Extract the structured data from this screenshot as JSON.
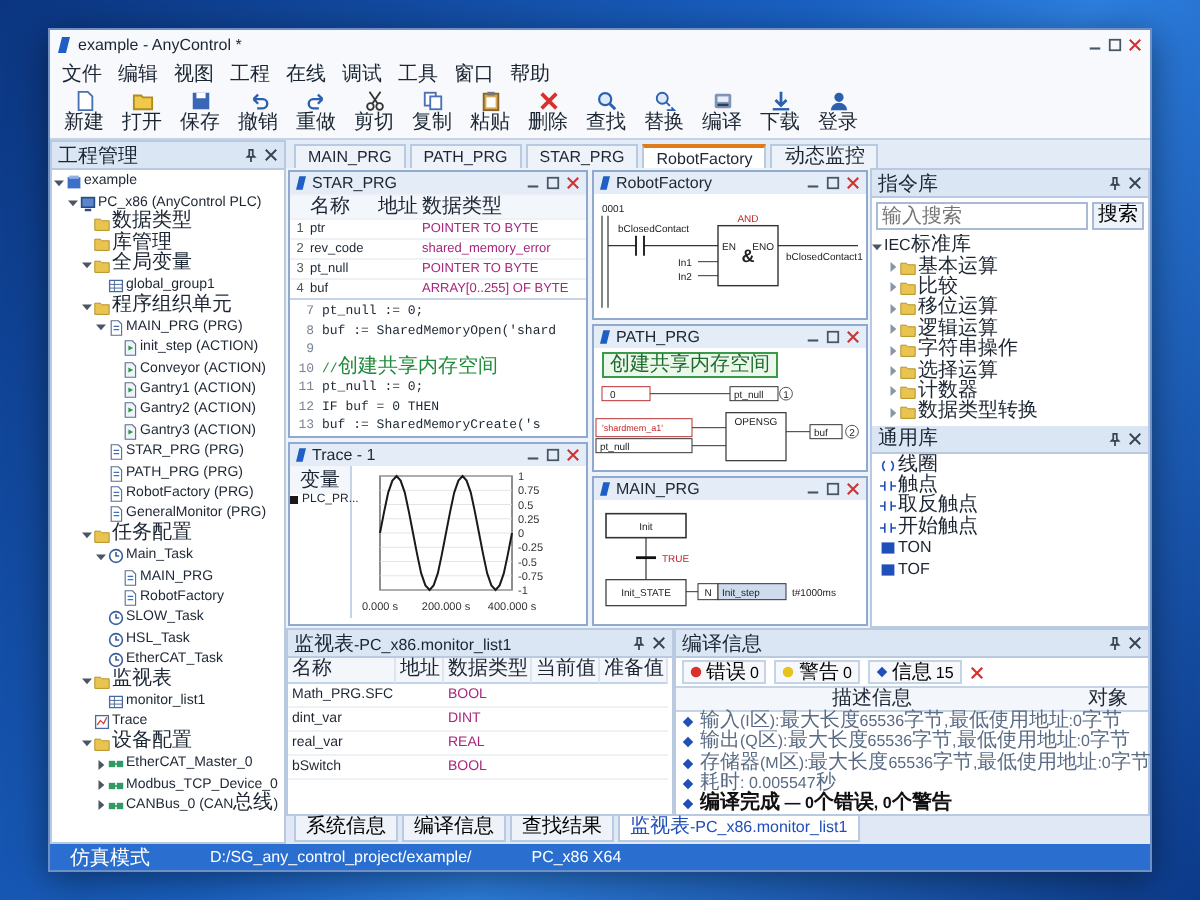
{
  "window": {
    "title": "example - AnyControl *"
  },
  "menu": [
    "文件",
    "编辑",
    "视图",
    "工程",
    "在线",
    "调试",
    "工具",
    "窗口",
    "帮助"
  ],
  "toolbar": [
    {
      "label": "新建",
      "kind": "new"
    },
    {
      "label": "打开",
      "kind": "open"
    },
    {
      "label": "保存",
      "kind": "save"
    },
    {
      "label": "撤销",
      "kind": "undo"
    },
    {
      "label": "重做",
      "kind": "redo"
    },
    {
      "label": "剪切",
      "kind": "cut"
    },
    {
      "label": "复制",
      "kind": "copy"
    },
    {
      "label": "粘贴",
      "kind": "paste"
    },
    {
      "label": "删除",
      "kind": "delete"
    },
    {
      "label": "查找",
      "kind": "find"
    },
    {
      "label": "替换",
      "kind": "replace"
    },
    {
      "label": "编译",
      "kind": "build"
    },
    {
      "label": "下载",
      "kind": "download"
    },
    {
      "label": "登录",
      "kind": "login"
    }
  ],
  "project": {
    "title": "工程管理",
    "tree": [
      {
        "label": "example",
        "kind": "project",
        "expanded": true,
        "children": [
          {
            "label": "PC_x86 (AnyControl PLC)",
            "kind": "device",
            "expanded": true,
            "children": [
              {
                "label": "数据类型",
                "kind": "folder"
              },
              {
                "label": "库管理",
                "kind": "folder"
              },
              {
                "label": "全局变量",
                "kind": "folder",
                "expanded": true,
                "children": [
                  {
                    "label": "global_group1",
                    "kind": "list"
                  }
                ]
              },
              {
                "label": "程序组织单元",
                "kind": "folder",
                "expanded": true,
                "children": [
                  {
                    "label": "MAIN_PRG (PRG)",
                    "kind": "pou",
                    "expanded": true,
                    "children": [
                      {
                        "label": "init_step (ACTION)",
                        "kind": "action"
                      },
                      {
                        "label": "Conveyor (ACTION)",
                        "kind": "action"
                      },
                      {
                        "label": "Gantry1 (ACTION)",
                        "kind": "action"
                      },
                      {
                        "label": "Gantry2 (ACTION)",
                        "kind": "action"
                      },
                      {
                        "label": "Gantry3 (ACTION)",
                        "kind": "action"
                      }
                    ]
                  },
                  {
                    "label": "STAR_PRG (PRG)",
                    "kind": "pou"
                  },
                  {
                    "label": "PATH_PRG (PRG)",
                    "kind": "pou"
                  },
                  {
                    "label": "RobotFactory (PRG)",
                    "kind": "pou"
                  },
                  {
                    "label": "GeneralMonitor (PRG)",
                    "kind": "pou"
                  }
                ]
              },
              {
                "label": "任务配置",
                "kind": "folder",
                "expanded": true,
                "children": [
                  {
                    "label": "Main_Task",
                    "kind": "task",
                    "expanded": true,
                    "children": [
                      {
                        "label": "MAIN_PRG",
                        "kind": "pou"
                      },
                      {
                        "label": "RobotFactory",
                        "kind": "pou"
                      }
                    ]
                  },
                  {
                    "label": "SLOW_Task",
                    "kind": "task"
                  },
                  {
                    "label": "HSL_Task",
                    "kind": "task"
                  },
                  {
                    "label": "EtherCAT_Task",
                    "kind": "task"
                  }
                ]
              },
              {
                "label": "监视表",
                "kind": "folder",
                "expanded": true,
                "children": [
                  {
                    "label": "monitor_list1",
                    "kind": "list"
                  }
                ]
              },
              {
                "label": "Trace",
                "kind": "trace"
              },
              {
                "label": "设备配置",
                "kind": "folder",
                "expanded": true,
                "children": [
                  {
                    "label": "EtherCAT_Master_0",
                    "kind": "bus",
                    "expanded": false
                  },
                  {
                    "label": "Modbus_TCP_Device_0",
                    "kind": "bus",
                    "expanded": false
                  },
                  {
                    "label": "CANBus_0 (CAN总线)",
                    "kind": "bus",
                    "expanded": false
                  }
                ]
              }
            ]
          }
        ]
      }
    ]
  },
  "editor_tabs": [
    {
      "label": "MAIN_PRG",
      "selected": false
    },
    {
      "label": "PATH_PRG",
      "selected": false
    },
    {
      "label": "STAR_PRG",
      "selected": false
    },
    {
      "label": "RobotFactory",
      "selected": true
    },
    {
      "label": "动态监控",
      "selected": false
    }
  ],
  "star_editor": {
    "title": "STAR_PRG",
    "columns": [
      "名称",
      "地址",
      "数据类型"
    ],
    "rows": [
      {
        "no": "1",
        "name": "ptr",
        "type": "POINTER TO BYTE"
      },
      {
        "no": "2",
        "name": "rev_code",
        "type": "shared_memory_error"
      },
      {
        "no": "3",
        "name": "pt_null",
        "type": "POINTER TO BYTE"
      },
      {
        "no": "4",
        "name": "buf",
        "type": "ARRAY[0..255] OF BYTE"
      }
    ],
    "code": [
      {
        "no": "7",
        "kind": "code",
        "text": "pt_null := 0;"
      },
      {
        "no": "8",
        "kind": "code",
        "text": "buf := SharedMemoryOpen('shard"
      },
      {
        "no": "9"
      },
      {
        "no": "10",
        "kind": "comment",
        "text": "//创建共享内存空间"
      },
      {
        "no": "11",
        "kind": "code",
        "text": "pt_null := 0;"
      },
      {
        "no": "12",
        "kind": "code",
        "text": "IF buf = 0 THEN"
      },
      {
        "no": "13",
        "kind": "code",
        "text": "  buf := SharedMemoryCreate('s"
      }
    ]
  },
  "trace": {
    "title": "Trace - 1",
    "legend_header": "变量",
    "chart_data": {
      "type": "line",
      "x": [
        0,
        12.5,
        25,
        37.5,
        50,
        62.5,
        75,
        87.5,
        100,
        112.5,
        125,
        137.5,
        150,
        162.5,
        175,
        187.5,
        200,
        212.5,
        225,
        237.5,
        250,
        262.5,
        275,
        287.5,
        300,
        312.5,
        325,
        337.5,
        350,
        362.5,
        375,
        387.5,
        400
      ],
      "series": [
        {
          "name": "PLC_PR...",
          "color": "#1a1a1a",
          "values": [
            0,
            0.38,
            0.71,
            0.92,
            1,
            0.92,
            0.71,
            0.38,
            0,
            -0.38,
            -0.71,
            -0.92,
            -1,
            -0.92,
            -0.71,
            -0.38,
            0,
            0.38,
            0.71,
            0.92,
            1,
            0.92,
            0.71,
            0.38,
            0,
            -0.38,
            -0.71,
            -0.92,
            -1,
            -0.92,
            -0.71,
            -0.38,
            0
          ]
        }
      ],
      "grid": true,
      "xlim": [
        0,
        400
      ],
      "ylim": [
        -1,
        1
      ],
      "xticks": [
        {
          "value": 0,
          "label": "0.000 s"
        },
        {
          "value": 200,
          "label": "200.000 s"
        },
        {
          "value": 400,
          "label": "400.000 s"
        }
      ],
      "yticks": [
        -1,
        -0.75,
        -0.5,
        -0.25,
        0,
        0.25,
        0.5,
        0.75,
        1
      ]
    }
  },
  "ladder": {
    "title": "RobotFactory",
    "rung": "0001",
    "contact": "bClosedContact",
    "block": "AND",
    "symbol": "&",
    "pin_in": "EN",
    "pin_out": "ENO",
    "inputs": [
      "In1",
      "In2"
    ],
    "output": "bClosedContact1"
  },
  "fbd": {
    "title": "PATH_PRG",
    "comment": "创建共享内存空间",
    "const": "0",
    "var1": "pt_null",
    "order1": "1",
    "in_a": "'shardmem_a1'",
    "in_b": "pt_null",
    "block": "OPENSG",
    "var2": "buf",
    "order2": "2"
  },
  "sfc": {
    "title": "MAIN_PRG",
    "init_step": "Init",
    "transition": "TRUE",
    "step": "Init_STATE",
    "qualifier": "N",
    "action": "Init_step",
    "time": "t#1000ms"
  },
  "library": {
    "title": "指令库",
    "placeholder": "输入搜索",
    "search_button": "搜索",
    "root": "IEC标准库",
    "folders": [
      "基本运算",
      "比较",
      "移位运算",
      "逻辑运算",
      "字符串操作",
      "选择运算",
      "计数器",
      "数据类型转换"
    ],
    "common_title": "通用库",
    "common": [
      {
        "label": "线圈",
        "kind": "coil"
      },
      {
        "label": "触点",
        "kind": "contact"
      },
      {
        "label": "取反触点",
        "kind": "contact"
      },
      {
        "label": "开始触点",
        "kind": "contact"
      },
      {
        "label": "TON",
        "kind": "block"
      },
      {
        "label": "TOF",
        "kind": "block"
      }
    ]
  },
  "monitor": {
    "title": "监视表-PC_x86.monitor_list1",
    "columns": [
      "名称",
      "地址",
      "数据类型",
      "当前值",
      "准备值"
    ],
    "rows": [
      {
        "name": "Math_PRG.SFC",
        "type": "BOOL"
      },
      {
        "name": "dint_var",
        "type": "DINT"
      },
      {
        "name": "real_var",
        "type": "REAL"
      },
      {
        "name": "bSwitch",
        "type": "BOOL"
      }
    ]
  },
  "compile": {
    "title": "编译信息",
    "filters": [
      {
        "kind": "error",
        "label": "错误 0"
      },
      {
        "kind": "warning",
        "label": "警告 0"
      },
      {
        "kind": "info",
        "label": "信息 15"
      }
    ],
    "columns": [
      "描述信息",
      "对象"
    ],
    "messages": [
      {
        "text": "输入(I区):最大长度65536字节,最低使用地址:0字节",
        "bold": false
      },
      {
        "text": "输出(Q区):最大长度65536字节,最低使用地址:0字节",
        "bold": false
      },
      {
        "text": "存储器(M区):最大长度65536字节,最低使用地址:0字节",
        "bold": false
      },
      {
        "text": "耗时: 0.005547秒",
        "bold": false
      },
      {
        "text": "编译完成 — 0个错误, 0个警告",
        "bold": true
      }
    ]
  },
  "bottom_tabs": [
    {
      "label": "系统信息",
      "selected": false
    },
    {
      "label": "编译信息",
      "selected": false
    },
    {
      "label": "查找结果",
      "selected": false
    },
    {
      "label": "监视表-PC_x86.monitor_list1",
      "selected": true
    }
  ],
  "status_bar": {
    "mode": "仿真模式",
    "path": "D:/SG_any_control_project/example/",
    "target": "PC_x86  X64"
  }
}
